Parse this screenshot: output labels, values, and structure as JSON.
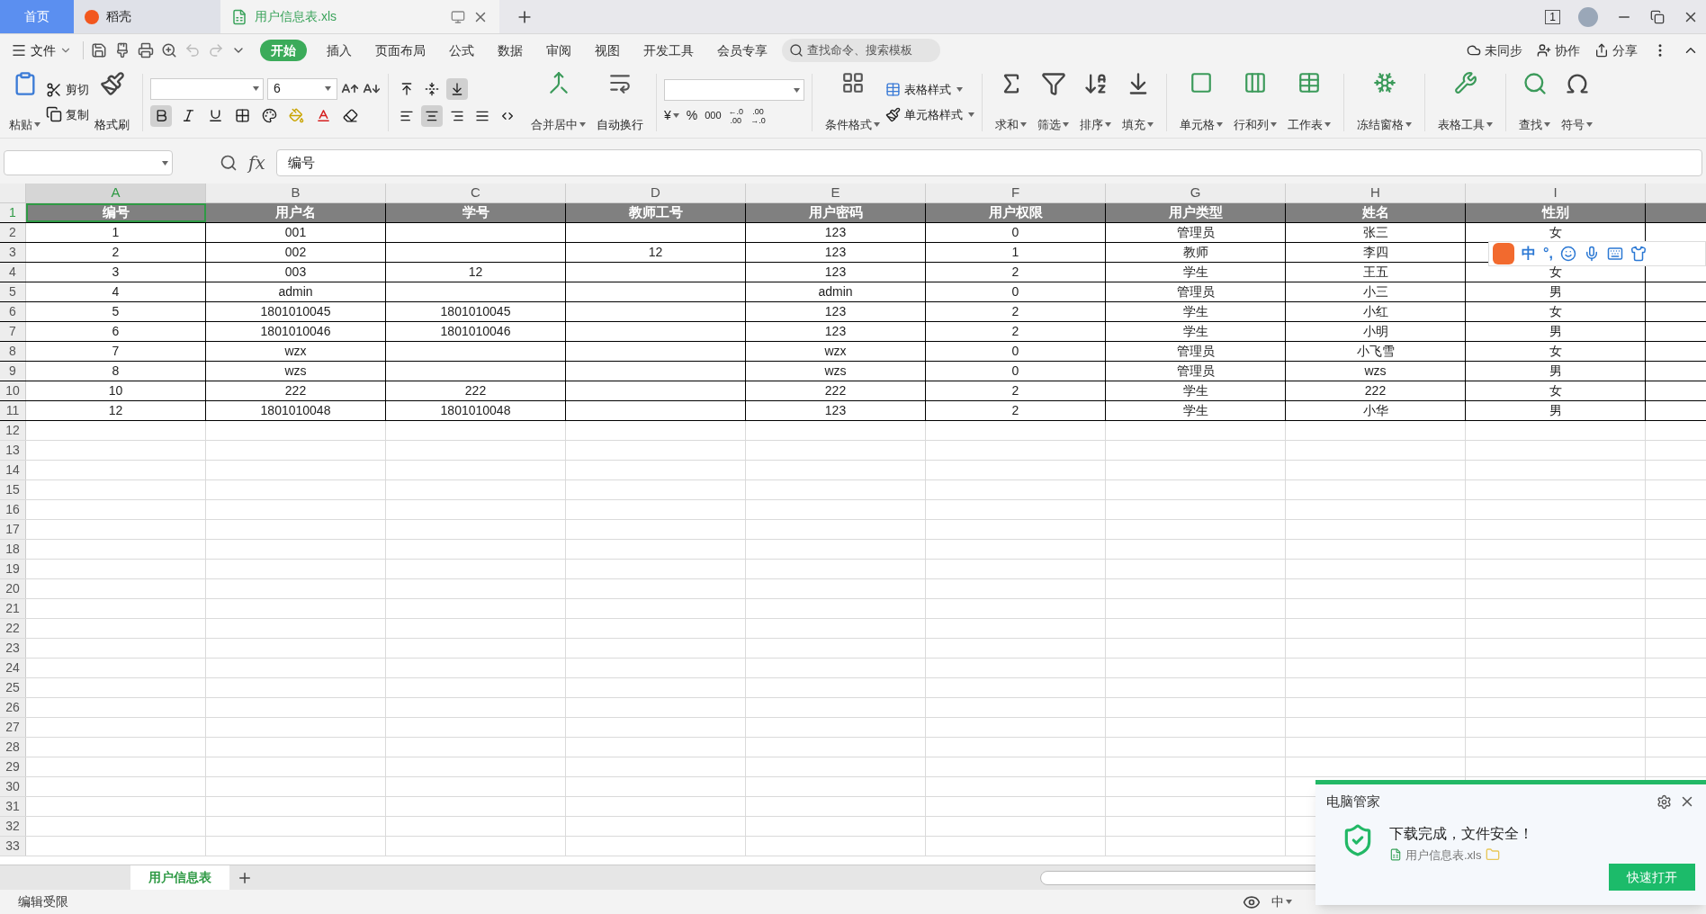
{
  "tabs": [
    {
      "label": "首页",
      "selected": false,
      "kind": "home"
    },
    {
      "label": "稻壳",
      "selected": false,
      "kind": "app"
    },
    {
      "label": "用户信息表.xls",
      "selected": true,
      "kind": "file"
    }
  ],
  "window_count": "1",
  "menu": {
    "file": "文件",
    "tabs": [
      {
        "label": "开始",
        "selected": true
      },
      {
        "label": "插入",
        "selected": false
      },
      {
        "label": "页面布局",
        "selected": false
      },
      {
        "label": "公式",
        "selected": false
      },
      {
        "label": "数据",
        "selected": false
      },
      {
        "label": "审阅",
        "selected": false
      },
      {
        "label": "视图",
        "selected": false
      },
      {
        "label": "开发工具",
        "selected": false
      },
      {
        "label": "会员专享",
        "selected": false
      }
    ],
    "search_placeholder": "查找命令、搜索模板",
    "sync": "未同步",
    "collab": "协作",
    "share": "分享"
  },
  "ribbon": {
    "clipboard": {
      "paste": "粘贴",
      "cut": "剪切",
      "copy": "复制",
      "format_painter": "格式刷"
    },
    "font": {
      "size": "6",
      "bold": true,
      "italic": false,
      "underline": false
    },
    "align": {
      "vertical": [
        {
          "selected": false
        },
        {
          "selected": false
        },
        {
          "selected": true
        }
      ],
      "horizontal": [
        {
          "selected": false
        },
        {
          "selected": true
        },
        {
          "selected": false
        },
        {
          "selected": false
        },
        {
          "selected": false
        }
      ],
      "merge": "合并居中",
      "wrap": "自动换行"
    },
    "number": {
      "currency": "¥",
      "percent": "%",
      "thousands": "000",
      "decimals": [
        {
          "top": "←.0",
          "bottom": ".00"
        },
        {
          "top": ".00",
          "bottom": "→.0"
        }
      ]
    },
    "styles": {
      "conditional": "条件格式",
      "table_style": "表格样式",
      "cell_style": "单元格样式"
    },
    "edit": [
      "求和",
      "筛选",
      "排序",
      "填充"
    ],
    "cells": [
      "单元格",
      "行和列",
      "工作表"
    ],
    "freeze": "冻结窗格",
    "tools": "表格工具",
    "find": [
      "查找",
      "符号"
    ]
  },
  "formula": {
    "fx": "fx",
    "value": "编号"
  },
  "columns": [
    {
      "label": "A",
      "selected": true
    },
    {
      "label": "B",
      "selected": false
    },
    {
      "label": "C",
      "selected": false
    },
    {
      "label": "D",
      "selected": false
    },
    {
      "label": "E",
      "selected": false
    },
    {
      "label": "F",
      "selected": false
    },
    {
      "label": "G",
      "selected": false
    },
    {
      "label": "H",
      "selected": false
    },
    {
      "label": "I",
      "selected": false
    }
  ],
  "header_row": {
    "number": "1",
    "cells": [
      {
        "text": "编号",
        "selected": true
      },
      {
        "text": "用户名",
        "selected": false
      },
      {
        "text": "学号",
        "selected": false
      },
      {
        "text": "教师工号",
        "selected": false
      },
      {
        "text": "用户密码",
        "selected": false
      },
      {
        "text": "用户权限",
        "selected": false
      },
      {
        "text": "用户类型",
        "selected": false
      },
      {
        "text": "姓名",
        "selected": false
      },
      {
        "text": "性别",
        "selected": false
      }
    ]
  },
  "rows": [
    {
      "number": "2",
      "cells": [
        "1",
        "001",
        "",
        "",
        "123",
        "0",
        "管理员",
        "张三",
        "女"
      ]
    },
    {
      "number": "3",
      "cells": [
        "2",
        "002",
        "",
        "12",
        "123",
        "1",
        "教师",
        "李四",
        ""
      ]
    },
    {
      "number": "4",
      "cells": [
        "3",
        "003",
        "12",
        "",
        "123",
        "2",
        "学生",
        "王五",
        "女"
      ]
    },
    {
      "number": "5",
      "cells": [
        "4",
        "admin",
        "",
        "",
        "admin",
        "0",
        "管理员",
        "小三",
        "男"
      ]
    },
    {
      "number": "6",
      "cells": [
        "5",
        "1801010045",
        "1801010045",
        "",
        "123",
        "2",
        "学生",
        "小红",
        "女"
      ]
    },
    {
      "number": "7",
      "cells": [
        "6",
        "1801010046",
        "1801010046",
        "",
        "123",
        "2",
        "学生",
        "小明",
        "男"
      ]
    },
    {
      "number": "8",
      "cells": [
        "7",
        "wzx",
        "",
        "",
        "wzx",
        "0",
        "管理员",
        "小飞雪",
        "女"
      ]
    },
    {
      "number": "9",
      "cells": [
        "8",
        "wzs",
        "",
        "",
        "wzs",
        "0",
        "管理员",
        "wzs",
        "男"
      ]
    },
    {
      "number": "10",
      "cells": [
        "10",
        "222",
        "222",
        "",
        "222",
        "2",
        "学生",
        "222",
        "女"
      ]
    },
    {
      "number": "11",
      "cells": [
        "12",
        "1801010048",
        "1801010048",
        "",
        "123",
        "2",
        "学生",
        "小华",
        "男"
      ]
    }
  ],
  "empty_rows": [
    "12",
    "13",
    "14",
    "15",
    "16",
    "17",
    "18",
    "19",
    "20",
    "21",
    "22",
    "23",
    "24",
    "25",
    "26",
    "27",
    "28",
    "29",
    "30",
    "31",
    "32",
    "33"
  ],
  "sheets": [
    {
      "label": "用户信息表",
      "selected": true
    }
  ],
  "status": {
    "text": "编辑受限",
    "ime": "中"
  },
  "ime_bar": {
    "mode": "中",
    "punct": "°,"
  },
  "popup": {
    "title": "电脑管家",
    "message": "下载完成，文件安全！",
    "file": "用户信息表.xls",
    "button": "快速打开"
  }
}
